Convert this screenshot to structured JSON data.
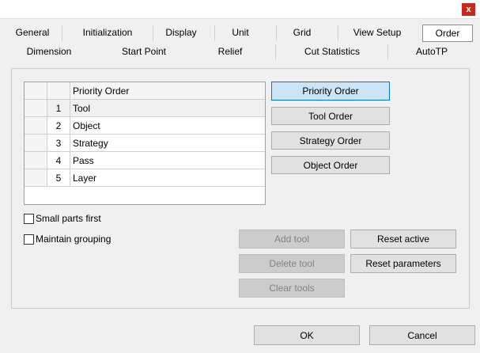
{
  "window": {
    "close_label": "x"
  },
  "tabs_row1": [
    {
      "label": "General"
    },
    {
      "label": "Initialization"
    },
    {
      "label": "Display"
    },
    {
      "label": "Unit"
    },
    {
      "label": "Grid"
    },
    {
      "label": "View Setup"
    },
    {
      "label": "Order"
    }
  ],
  "tabs_row2": [
    {
      "label": "Dimension"
    },
    {
      "label": "Start Point"
    },
    {
      "label": "Relief"
    },
    {
      "label": "Cut Statistics"
    },
    {
      "label": "AutoTP"
    }
  ],
  "active_tab": "Order",
  "grid": {
    "header": "Priority Order",
    "rows": [
      {
        "num": "1",
        "label": "Tool"
      },
      {
        "num": "2",
        "label": "Object"
      },
      {
        "num": "3",
        "label": "Strategy"
      },
      {
        "num": "4",
        "label": "Pass"
      },
      {
        "num": "5",
        "label": "Layer"
      }
    ]
  },
  "order_buttons": {
    "priority": "Priority Order",
    "tool": "Tool Order",
    "strategy": "Strategy Order",
    "object": "Object Order"
  },
  "options": {
    "small_parts_first": "Small parts first",
    "maintain_grouping": "Maintain grouping"
  },
  "actions": {
    "add_tool": "Add tool",
    "delete_tool": "Delete tool",
    "clear_tools": "Clear tools",
    "reset_active": "Reset active",
    "reset_parameters": "Reset parameters"
  },
  "footer": {
    "ok": "OK",
    "cancel": "Cancel"
  }
}
